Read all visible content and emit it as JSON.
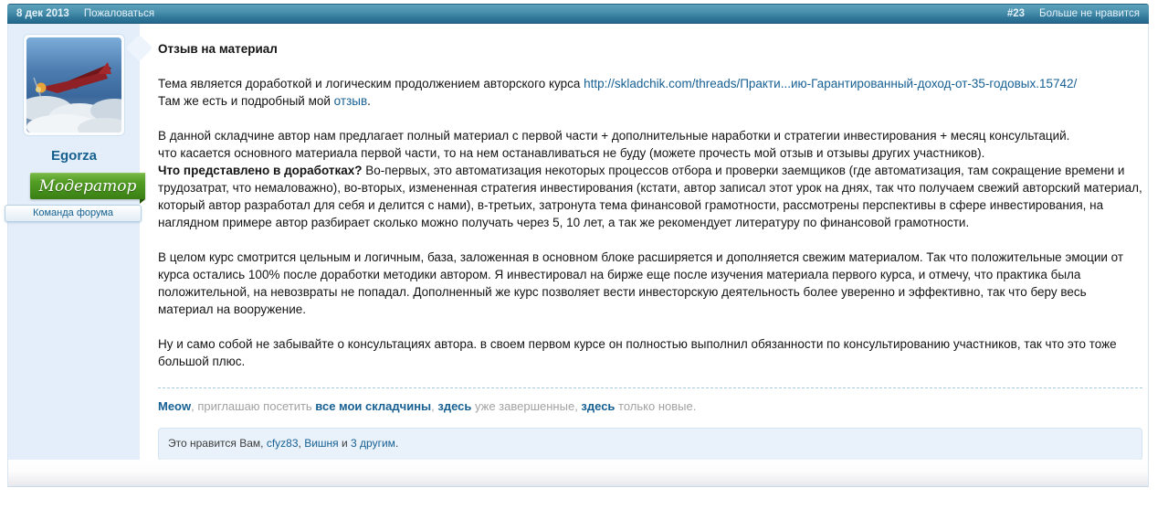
{
  "header": {
    "date": "8 дек 2013",
    "report_link": "Пожаловаться",
    "post_number": "#23",
    "unlike_link": "Больше не нравится"
  },
  "sidebar": {
    "username": "Egorza",
    "banner": "Модератор",
    "team": "Команда форума",
    "avatar_description": "red airplane flying over clouds"
  },
  "post": {
    "title": "Отзыв на материал",
    "p1": {
      "t1": "Тема является доработкой и логическим продолжением авторского курса ",
      "thread_link": "http://skladchik.com/threads/Практи...ию-Гарантированный-доход-от-35-годовых.15742/",
      "t2": "Там же есть и подробный мой ",
      "review_link": "отзыв",
      "t3": "."
    },
    "p2": {
      "l1": "В данной складчине автор нам предлагает полный материал с первой части + дополнительные наработки и стратегии инвестирования + месяц консультаций.",
      "l2": "что касается основного материала первой части, то на нем останавливаться не буду (можете прочесть мой отзыв и отзывы других участников).",
      "bold": "Что представлено в доработках?",
      "rest": " Во-первых, это автоматизация некоторых процессов отбора и проверки заемщиков (где автоматизация, там сокращение времени и трудозатрат, что немаловажно), во-вторых, измененная стратегия инвестирования (кстати, автор записал этот урок на днях, так что получаем свежий авторский материал, который автор разработал для себя и делится с нами), в-третьих, затронута тема финансовой грамотности, рассмотрены перспективы в сфере инвестирования, на наглядном примере автор разбирает сколько можно получать через 5, 10 лет, а так же рекомендует литературу по финансовой грамотности."
    },
    "p3": "В целом курс смотрится цельным и логичным, база, заложенная в основном блоке расширяется и дополняется свежим материалом. Так что положительные эмоции от курса остались 100% после доработки методики автором. Я инвестировал на бирже еще после изучения материала первого курса, и отмечу, что практика была положительной, на невозвраты не попадал. Дополненный же курс позволяет вести инвесторскую деятельность более уверенно и эффективно, так что беру весь материал на вооружение.",
    "p4": "Ну и само собой не забывайте о консультациях автора. в своем первом курсе он полностью выполнил обязанности по консультированию участников, так что это тоже большой плюс."
  },
  "signature": {
    "user": "Meow",
    "t1": ", приглашаю посетить ",
    "all_link": "все мои складчины",
    "t2": ", ",
    "done_link": "здесь",
    "t3": " уже завершенные, ",
    "new_link": "здесь",
    "t4": " только новые."
  },
  "likes": {
    "t1": "Это нравится Вам, ",
    "user1": "cfyz83",
    "sep": ", ",
    "user2": "Вишня",
    "t2": " и ",
    "more_link": "3 другим",
    "t3": "."
  },
  "colors": {
    "link": "#176093",
    "header_gradient_top": "#5ea2bb",
    "header_gradient_bottom": "#246a8e",
    "sidebar_bg": "#e4eefa",
    "banner_green": "#47911d",
    "signature_red": "#ff0000",
    "signature_blue": "#0000ff",
    "signature_green": "#008000",
    "likes_bg": "#e9f2fb"
  }
}
